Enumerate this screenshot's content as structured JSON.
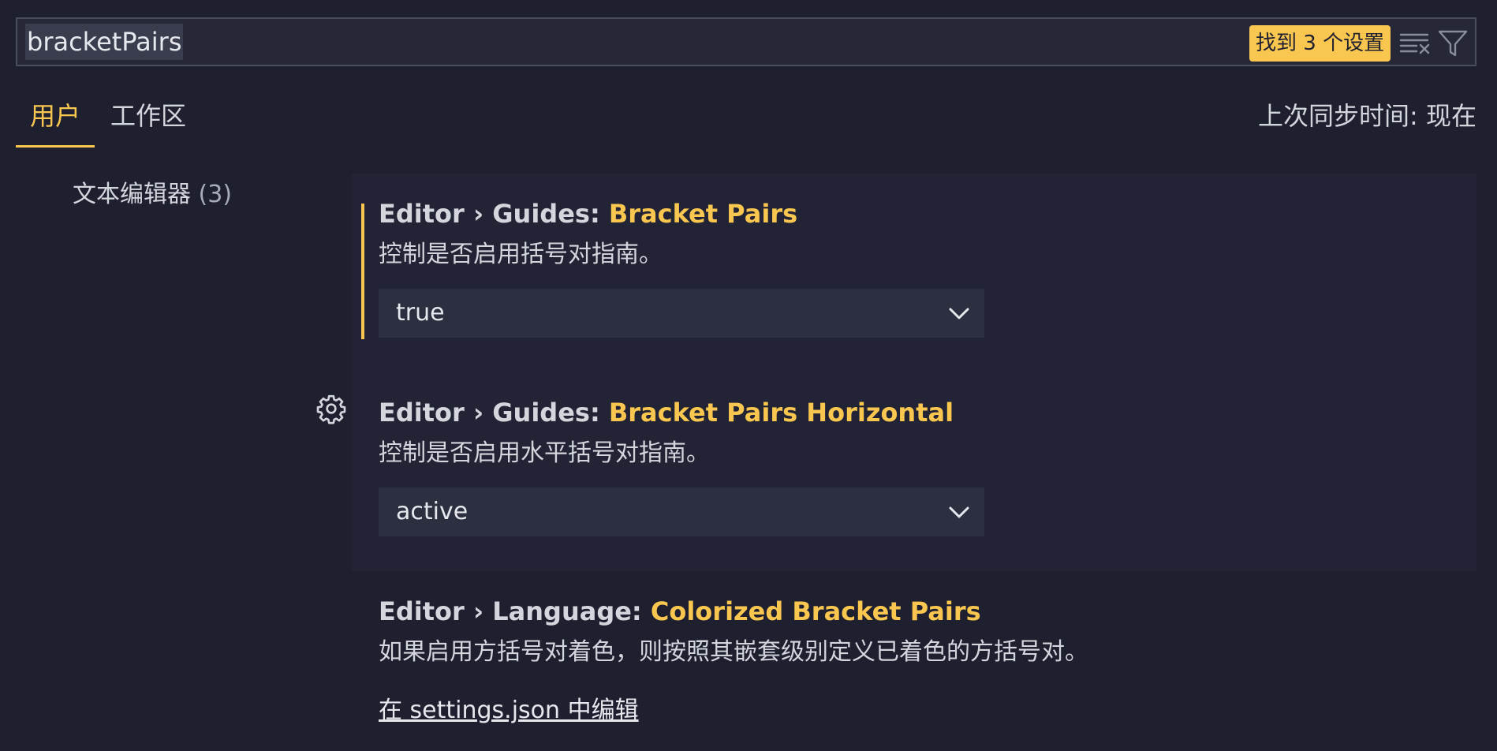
{
  "search": {
    "query": "bracketPairs",
    "result_count_label": "找到 3 个设置"
  },
  "tabs": {
    "user": "用户",
    "workspace": "工作区"
  },
  "sync_status": "上次同步时间: 现在",
  "toc": {
    "label": "文本编辑器",
    "count": "(3)"
  },
  "settings": [
    {
      "category": "Editor › Guides: ",
      "name": "Bracket Pairs",
      "description": "控制是否启用括号对指南。",
      "value": "true"
    },
    {
      "category": "Editor › Guides: ",
      "name": "Bracket Pairs Horizontal",
      "description": "控制是否启用水平括号对指南。",
      "value": "active"
    },
    {
      "category": "Editor › Language: ",
      "name": "Colorized Bracket Pairs",
      "description": "如果启用方括号对着色，则按照其嵌套级别定义已着色的方括号对。",
      "link": "在 settings.json 中编辑"
    }
  ],
  "colors": {
    "accent": "#f9c64f",
    "background": "#1e2030"
  },
  "icons": {
    "clear": "clear-filter-icon",
    "filter": "filter-icon",
    "gear": "gear-icon",
    "chevron": "chevron-down-icon"
  }
}
